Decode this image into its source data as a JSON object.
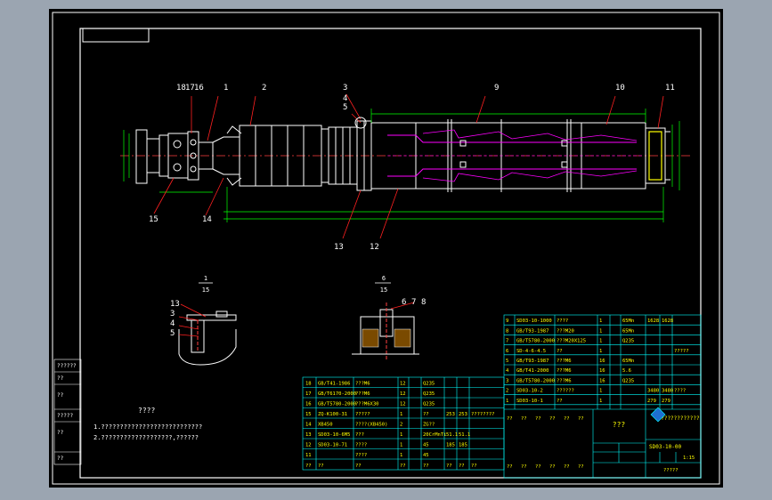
{
  "drawing": {
    "part_numbers": [
      "18",
      "17",
      "16",
      "1",
      "2",
      "3",
      "4",
      "5",
      "9",
      "10",
      "11",
      "15",
      "14",
      "13",
      "12"
    ],
    "section_a": {
      "numerator": "1",
      "denominator": "15",
      "callouts": [
        "13",
        "3",
        "4",
        "5"
      ]
    },
    "section_b": {
      "numerator": "6",
      "denominator": "15",
      "callouts": [
        "6",
        "7",
        "8"
      ]
    },
    "notes_title": "????",
    "notes": [
      "1.???????????????????????????",
      "2.???????????????????,??????"
    ],
    "side_labels": [
      "??????",
      "??",
      "??",
      "?????",
      "??",
      "??"
    ],
    "colors": {
      "frame": "#ffffff",
      "outline": "#ffffff",
      "dims": "#00ff00",
      "hidden": "#ff00ff",
      "callout": "#ff0000",
      "table": "#00ffff",
      "text": "#ffff00"
    }
  },
  "bom_left": {
    "rows": [
      [
        "18",
        "GB/T41-1986",
        "???M6",
        "12",
        "",
        "Q235",
        "",
        "",
        ""
      ],
      [
        "17",
        "GB/T6170-2000",
        "???M6",
        "12",
        "",
        "Q235",
        "",
        "",
        ""
      ],
      [
        "16",
        "GB/T5780-2000",
        "???M6X30",
        "12",
        "",
        "Q235",
        "",
        "",
        ""
      ],
      [
        "15",
        "ZQ-K100-31",
        "?????",
        "1",
        "",
        "??",
        "253",
        "253",
        "????????"
      ],
      [
        "14",
        "XB450",
        "????(XB450)",
        "2",
        "",
        "ZG??",
        "",
        "",
        ""
      ],
      [
        "13",
        "SD03-10-6M5",
        "???",
        "1",
        "",
        "20CrMnTi",
        "51.1",
        "51.1",
        ""
      ],
      [
        "12",
        "SD03-10-71",
        "????",
        "1",
        "",
        "45",
        "185",
        "185",
        ""
      ],
      [
        "11",
        "",
        "????",
        "1",
        "",
        "45",
        "",
        "",
        ""
      ]
    ],
    "header": [
      "??",
      "??",
      "??",
      "??",
      "",
      "??",
      "??",
      "??",
      "??"
    ]
  },
  "bom_right": {
    "rows": [
      [
        "9",
        "SD03-10-1000",
        "????",
        "1",
        "",
        "65Mn",
        "1628",
        "1628",
        ""
      ],
      [
        "8",
        "GB/T93-1987",
        "???M20",
        "1",
        "",
        "65Mn",
        "",
        "",
        ""
      ],
      [
        "7",
        "GB/T5780-2000",
        "???M20X125",
        "1",
        "",
        "Q235",
        "",
        "",
        ""
      ],
      [
        "6",
        "SD-4-6-4.5",
        "??",
        "1",
        "",
        "",
        "",
        "",
        "?????"
      ],
      [
        "5",
        "GB/T93-1987",
        "???M6",
        "16",
        "",
        "65Mn",
        "",
        "",
        ""
      ],
      [
        "4",
        "GB/T41-2000",
        "???M6",
        "16",
        "",
        "5.6",
        "",
        "",
        ""
      ],
      [
        "3",
        "GB/T5780-2000",
        "???M6",
        "16",
        "",
        "Q235",
        "",
        "",
        ""
      ],
      [
        "2",
        "SD03-10-2",
        "??????",
        "1",
        "",
        "",
        "3480",
        "3480",
        "????"
      ],
      [
        "1",
        "SD03-10-1",
        "??",
        "1",
        "",
        "",
        "279",
        "279",
        ""
      ]
    ]
  },
  "title_block": {
    "drawing_name": "???",
    "company": "??????????????",
    "drawing_code": "SD03-10-00",
    "scale": "1:15",
    "sheet": "?????",
    "labels": [
      "??",
      "??",
      "??",
      "??",
      "??",
      "??",
      "??",
      "??",
      "??",
      "??",
      "??",
      "??"
    ]
  }
}
